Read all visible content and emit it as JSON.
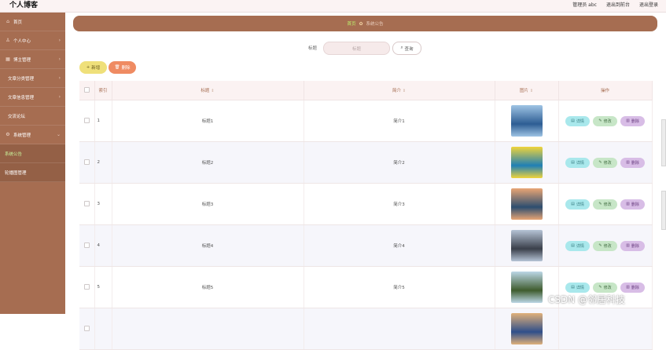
{
  "brand": "个人博客",
  "header": {
    "links": [
      "管理员 abc",
      "退出到前台",
      "退出登录"
    ]
  },
  "sidebar": {
    "items": [
      {
        "label": "首页",
        "icon": "home-icon",
        "has_chevron": false,
        "type": "top"
      },
      {
        "label": "个人中心",
        "icon": "user-icon",
        "has_chevron": true,
        "type": "top"
      },
      {
        "label": "博主管理",
        "icon": "grid-icon",
        "has_chevron": true,
        "type": "top"
      },
      {
        "label": "文章分类管理",
        "icon": "",
        "has_chevron": true,
        "type": "sub"
      },
      {
        "label": "文章信息管理",
        "icon": "",
        "has_chevron": true,
        "type": "sub"
      },
      {
        "label": "交流论坛",
        "icon": "",
        "has_chevron": false,
        "type": "sub"
      },
      {
        "label": "系统管理",
        "icon": "gear-icon",
        "has_chevron": true,
        "type": "top"
      },
      {
        "label": "系统公告",
        "icon": "",
        "has_chevron": false,
        "type": "child",
        "active": true
      },
      {
        "label": "轮播图管理",
        "icon": "",
        "has_chevron": false,
        "type": "child"
      }
    ]
  },
  "breadcrumb": {
    "home": "首页",
    "separator": "✿",
    "current": "系统公告"
  },
  "search": {
    "label": "标题",
    "placeholder": "标题",
    "button": "查询"
  },
  "actions": {
    "add": "新增",
    "delete": "删除"
  },
  "table": {
    "columns": {
      "index": "索引",
      "title": "标题",
      "summary": "简介",
      "image": "图片",
      "operation": "操作"
    },
    "row_buttons": {
      "detail": "详情",
      "edit": "修改",
      "delete": "删除"
    },
    "rows": [
      {
        "index": "1",
        "title": "标题1",
        "summary": "简介1",
        "image_colors": [
          "#2d5d93",
          "#9fc4e4"
        ]
      },
      {
        "index": "2",
        "title": "标题2",
        "summary": "简介2",
        "image_colors": [
          "#1f7fb5",
          "#f0d43a"
        ]
      },
      {
        "index": "3",
        "title": "标题3",
        "summary": "简介3",
        "image_colors": [
          "#2c4d6f",
          "#e9a574"
        ]
      },
      {
        "index": "4",
        "title": "标题4",
        "summary": "简介4",
        "image_colors": [
          "#3a3f4a",
          "#b6c4d6"
        ]
      },
      {
        "index": "5",
        "title": "标题5",
        "summary": "简介5",
        "image_colors": [
          "#3f5c2e",
          "#bcd7e6"
        ]
      },
      {
        "index": "",
        "title": "",
        "summary": "",
        "image_colors": [
          "#2f4f8a",
          "#e0b07a"
        ]
      }
    ]
  },
  "watermark": "CSDN @邻居科技",
  "colors": {
    "primary": "#a66d51",
    "active_menu": "#c9f19a",
    "add_button": "#efe07a",
    "delete_button": "#ef8b62",
    "detail_button": "#a9e8ec",
    "edit_button": "#c7e6c7",
    "row_delete_button": "#d8bde6"
  }
}
